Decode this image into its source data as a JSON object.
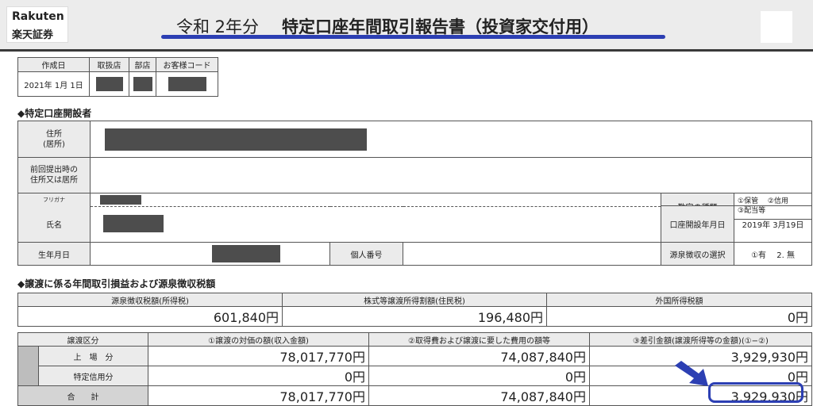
{
  "header": {
    "logo_top": "Rakuten",
    "logo_bottom": "楽天証券",
    "title_year": "令和  2年分",
    "title_main": "特定口座年間取引報告書（投資家交付用）",
    "accent_color": "#2c3fb3"
  },
  "meta": {
    "headers": [
      "作成日",
      "取扱店",
      "部店",
      "お客様コード"
    ],
    "created_date": "2021年 1月 1日"
  },
  "section1": {
    "title": "◆特定口座開設者",
    "address_label": "住所\n(居所)",
    "prev_address_label": "前回提出時の\n住所又は居所",
    "furigana_label": "フリガナ",
    "name_label": "氏名",
    "birth_label": "生年月日",
    "mynumber_label": "個人番号",
    "account_type_label": "勘定の種類",
    "account_type_opt1": "①保管　 ②信用",
    "account_type_opt2": "③配当等",
    "open_date_label": "口座開設年月日",
    "open_date": "2019年 3月19日",
    "withholding_label": "源泉徴収の選択",
    "withholding_value": "①有　 2. 無"
  },
  "section2": {
    "title": "◆譲渡に係る年間取引損益および源泉徴収税額",
    "tax_headers": [
      "源泉徴収税額(所得税)",
      "株式等譲渡所得割額(住民税)",
      "外国所得税額"
    ],
    "tax_values": [
      "601,840円",
      "196,480円",
      "0円"
    ],
    "col_headers": [
      "譲渡区分",
      "①譲渡の対価の額(収入金額)",
      "②取得費および譲渡に要した費用の額等",
      "③差引金額(譲渡所得等の金額)(①−②)"
    ],
    "rows": [
      {
        "label": "上　場　分",
        "v1": "78,017,770円",
        "v2": "74,087,840円",
        "v3": "3,929,930円"
      },
      {
        "label": "特定信用分",
        "v1": "0円",
        "v2": "0円",
        "v3": "0円"
      },
      {
        "label": "合　　計",
        "v1": "78,017,770円",
        "v2": "74,087,840円",
        "v3": "3,929,930円"
      }
    ]
  }
}
